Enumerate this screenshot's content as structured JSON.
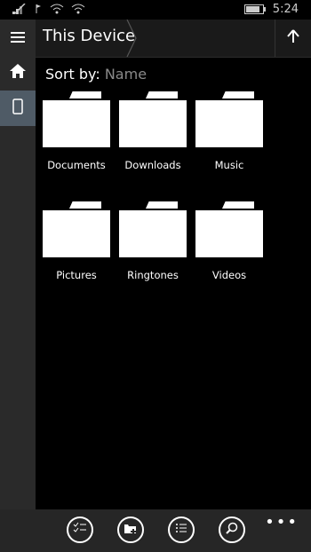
{
  "status_bar": {
    "time": "5:24",
    "icons_left": [
      "signal-icon",
      "flag-icon",
      "wifi-icon",
      "wifi-icon-2"
    ],
    "battery_level": 0.85
  },
  "sidebar": {
    "items": [
      {
        "icon": "hamburger-menu-icon",
        "active": false
      },
      {
        "icon": "home-icon",
        "active": false
      },
      {
        "icon": "phone-icon",
        "active": true
      }
    ]
  },
  "header": {
    "title": "This Device",
    "up_icon": "up-arrow-icon"
  },
  "sort": {
    "label": "Sort by:",
    "value": "Name"
  },
  "folders": [
    {
      "name": "Documents"
    },
    {
      "name": "Downloads"
    },
    {
      "name": "Music"
    },
    {
      "name": "Pictures"
    },
    {
      "name": "Ringtones"
    },
    {
      "name": "Videos"
    }
  ],
  "app_bar": {
    "buttons": [
      {
        "icon": "select-list-icon"
      },
      {
        "icon": "new-folder-icon"
      },
      {
        "icon": "list-view-icon"
      },
      {
        "icon": "search-icon"
      }
    ],
    "more": "•••"
  },
  "colors": {
    "background": "#000000",
    "sidebar": "#2a2a2a",
    "header": "#1a1a1a",
    "active_sidebar": "#4f5b66",
    "bottom_bar": "#262626",
    "sort_value": "#8a8a8a"
  }
}
